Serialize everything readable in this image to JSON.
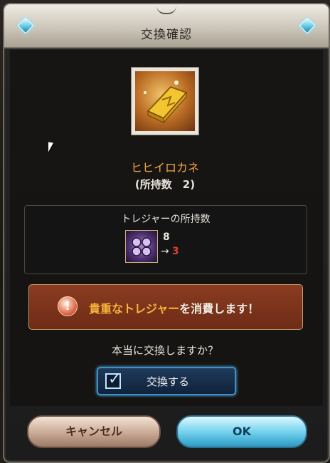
{
  "dialog": {
    "title": "交換確認",
    "item": {
      "name": "ヒヒイロカネ",
      "count_text": "(所持数　2)"
    },
    "treasure": {
      "label": "トレジャーの所持数",
      "before": "8",
      "arrow": "→",
      "after": "3"
    },
    "warning": {
      "highlight": "貴重なトレジャー",
      "rest": "を消費します！"
    },
    "question": "本当に交換しますか？",
    "checkbox": {
      "label": "交換する",
      "checked": true
    },
    "buttons": {
      "cancel": "キャンセル",
      "ok": "OK"
    }
  },
  "colors": {
    "item_name": "#f4a440",
    "warning_highlight": "#f7b43a",
    "after_value": "#e0402c",
    "accent_blue": "#3d8fc4"
  },
  "icons": [
    "gold-ingot-icon",
    "treasure-icon",
    "warning-icon",
    "checkmark-icon",
    "diamond-gem-icon"
  ]
}
